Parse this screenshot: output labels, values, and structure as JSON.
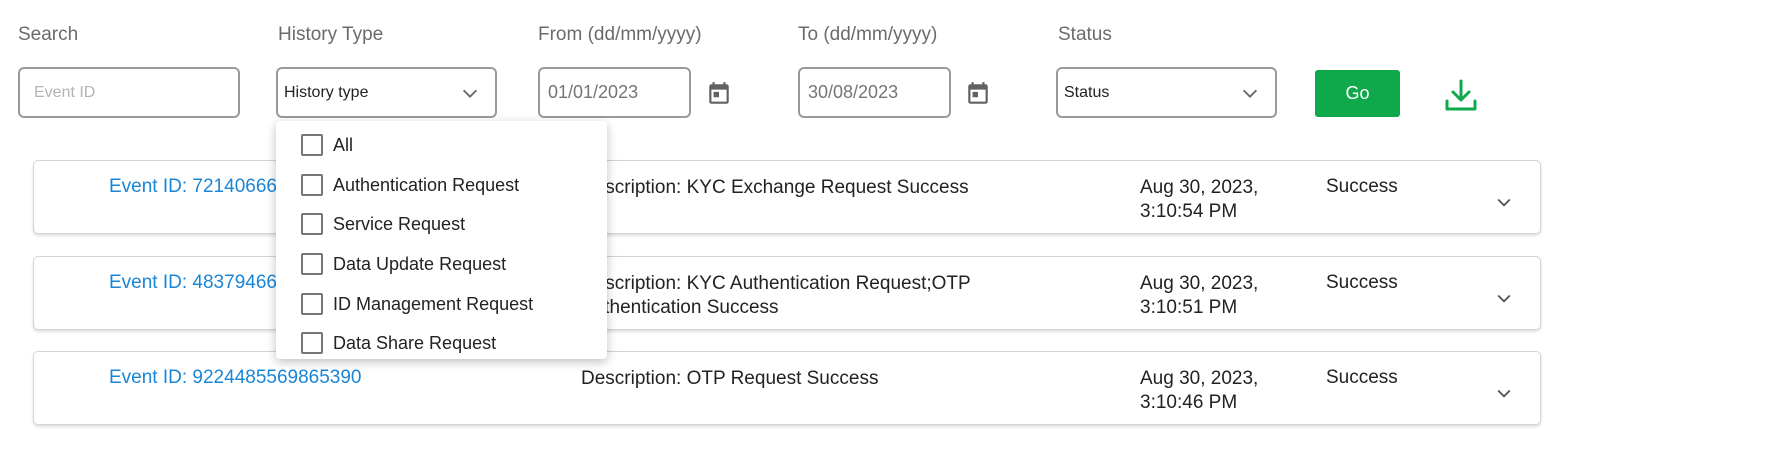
{
  "filters": {
    "search": {
      "label": "Search",
      "placeholder": "Event ID"
    },
    "history_type": {
      "label": "History Type",
      "selected": "History type",
      "options": [
        "All",
        "Authentication Request",
        "Service Request",
        "Data Update Request",
        "ID Management Request",
        "Data Share Request"
      ]
    },
    "from": {
      "label": "From (dd/mm/yyyy)",
      "value": "01/01/2023"
    },
    "to": {
      "label": "To (dd/mm/yyyy)",
      "value": "30/08/2023"
    },
    "status": {
      "label": "Status",
      "selected": "Status"
    },
    "go_label": "Go"
  },
  "events": [
    {
      "event_id": "Event ID: 72140666",
      "description": "Description: KYC Exchange Request Success",
      "datetime": "Aug 30, 2023, 3:10:54 PM",
      "status": "Success"
    },
    {
      "event_id": "Event ID: 48379466",
      "description": "Description: KYC Authentication Request;OTP Authentication Success",
      "datetime": "Aug 30, 2023, 3:10:51 PM",
      "status": "Success"
    },
    {
      "event_id": "Event ID: 9224485569865390",
      "description": "Description: OTP Request Success",
      "datetime": "Aug 30, 2023, 3:10:46 PM",
      "status": "Success"
    }
  ],
  "colors": {
    "accent_green": "#0fa84a",
    "link_blue": "#1a86d8"
  },
  "icons": {
    "calendar": "calendar-icon",
    "download": "download-icon",
    "chevron": "chevron-down-icon"
  }
}
